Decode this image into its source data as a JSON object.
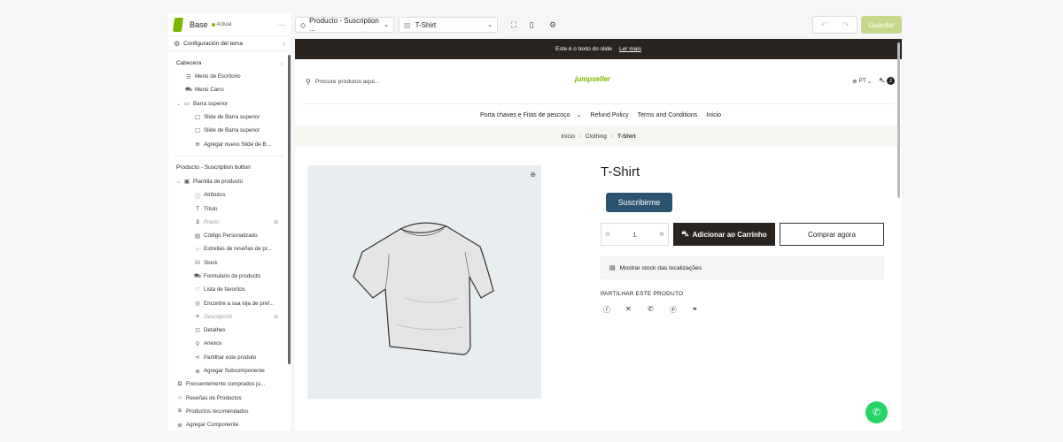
{
  "sidebar": {
    "theme_name": "Base",
    "theme_status": "Actual",
    "menu_glyph": "···",
    "config_label": "Configuración del tema",
    "section_header": "Cabecera",
    "header_items": [
      {
        "label": "Menú de Escritorio",
        "icon": "☰"
      },
      {
        "label": "Menú Carro",
        "icon": "⛟"
      }
    ],
    "top_bar": {
      "label": "Barra superior",
      "icon": "▭"
    },
    "top_bar_items": [
      {
        "label": "Slide de Barra superior",
        "icon": "☐"
      },
      {
        "label": "Slide de Barra superior",
        "icon": "☐"
      },
      {
        "label": "Agregar nuevo Slide de B...",
        "icon": "⊕"
      }
    ],
    "section_product": "Producto - Suscription button",
    "template": {
      "label": "Plantilla de producto",
      "icon": "▣"
    },
    "template_items": [
      {
        "label": "Atributos",
        "icon": "ⓘ",
        "hidden": false
      },
      {
        "label": "Título",
        "icon": "T",
        "hidden": false
      },
      {
        "label": "Precio",
        "icon": "$",
        "hidden": true
      },
      {
        "label": "Código Personalizado",
        "icon": "▤",
        "hidden": false
      },
      {
        "label": "Estrellas de reseñas de pr...",
        "icon": "☆",
        "hidden": false
      },
      {
        "label": "Stock",
        "icon": "⛁",
        "hidden": false
      },
      {
        "label": "Formulario de producto",
        "icon": "⛟",
        "hidden": false
      },
      {
        "label": "Lista de favoritos",
        "icon": "♡",
        "hidden": false
      },
      {
        "label": "Encontre a sua loja de pref...",
        "icon": "◎",
        "hidden": false
      },
      {
        "label": "Descripción",
        "icon": "≡",
        "hidden": true
      },
      {
        "label": "Detalhes",
        "icon": "☷",
        "hidden": false
      },
      {
        "label": "Anexos",
        "icon": "⚲",
        "hidden": false
      },
      {
        "label": "Partilhar este produto",
        "icon": "⋖",
        "hidden": false
      },
      {
        "label": "Agregar Subcomponente",
        "icon": "⊕",
        "hidden": false
      }
    ],
    "bottom_items": [
      {
        "label": "Frecuentemente comprados ju...",
        "icon": "⧉"
      },
      {
        "label": "Reseñas de Productos",
        "icon": "☆"
      },
      {
        "label": "Productos recomendados",
        "icon": "⧈"
      },
      {
        "label": "Agregar Componente",
        "icon": "⊕"
      }
    ]
  },
  "toolbar": {
    "page_select": "Producto - Suscription ...",
    "product_select": "T-Shirt",
    "save_label": "Guardar"
  },
  "preview": {
    "announcement": "Este é o texto do slide",
    "announcement_link": "Ler mais",
    "search_placeholder": "Procure produtos aqui...",
    "logo_text": "jumpseller",
    "language": "PT",
    "cart_count": "2",
    "nav": [
      "Porta chaves e Fitas de pescoço",
      "Refund Policy",
      "Terms and Conditions",
      "Início"
    ],
    "breadcrumb": [
      "Início",
      "Clothing",
      "T-Shirt"
    ],
    "product_title": "T-Shirt",
    "subscribe_label": "Suscribirme",
    "quantity": "1",
    "add_to_cart": "Adicionar ao Carrinho",
    "buy_now": "Comprar agora",
    "stock_label": "Mostrar stock das localizações",
    "share_title": "PARTILHAR ESTE PRODUTO"
  },
  "colors": {
    "accent": "#7ab800",
    "subscribe_bg": "#2c5470",
    "dark": "#2a2420",
    "save_disabled": "#c6d88b",
    "whatsapp": "#25d366"
  }
}
